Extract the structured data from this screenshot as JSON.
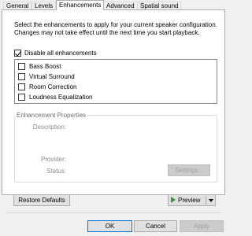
{
  "tabs": [
    {
      "label": "General",
      "active": false
    },
    {
      "label": "Levels",
      "active": false
    },
    {
      "label": "Enhancements",
      "active": true
    },
    {
      "label": "Advanced",
      "active": false
    },
    {
      "label": "Spatial sound",
      "active": false
    }
  ],
  "description": "Select the enhancements to apply for your current speaker configuration. Changes may not take effect until the next time you start playback.",
  "disable_all": {
    "label": "Disable all enhancements",
    "checked": true
  },
  "enhancements": [
    {
      "label": "Bass Boost",
      "checked": false
    },
    {
      "label": "Virtual Surround",
      "checked": false
    },
    {
      "label": "Room Correction",
      "checked": false
    },
    {
      "label": "Loudness Equalization",
      "checked": false
    }
  ],
  "properties": {
    "title": "Enhancement Properties",
    "description_label": "Description:",
    "provider_label": "Provider:",
    "status_label": "Status:",
    "settings_button": "Settings..."
  },
  "buttons": {
    "restore_defaults": "Restore Defaults",
    "preview": "Preview",
    "ok": "OK",
    "cancel": "Cancel",
    "apply": "Apply"
  },
  "colors": {
    "accent": "#0078d7",
    "play_icon": "#2e9e3a"
  }
}
